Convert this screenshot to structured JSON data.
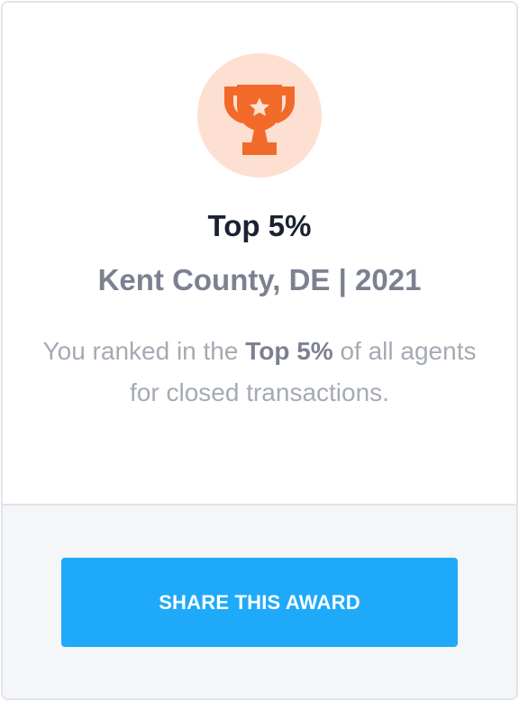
{
  "award": {
    "icon": "trophy-icon",
    "icon_color": "#f26a2a",
    "circle_color": "#fde0d1",
    "title": "Top 5%",
    "subtitle": "Kent County, DE | 2021",
    "description_prefix": "You ranked in the ",
    "description_emphasis": "Top 5%",
    "description_suffix": " of all agents for closed transactions."
  },
  "share": {
    "button_label": "SHARE THIS AWARD",
    "button_color": "#1faaf9"
  }
}
